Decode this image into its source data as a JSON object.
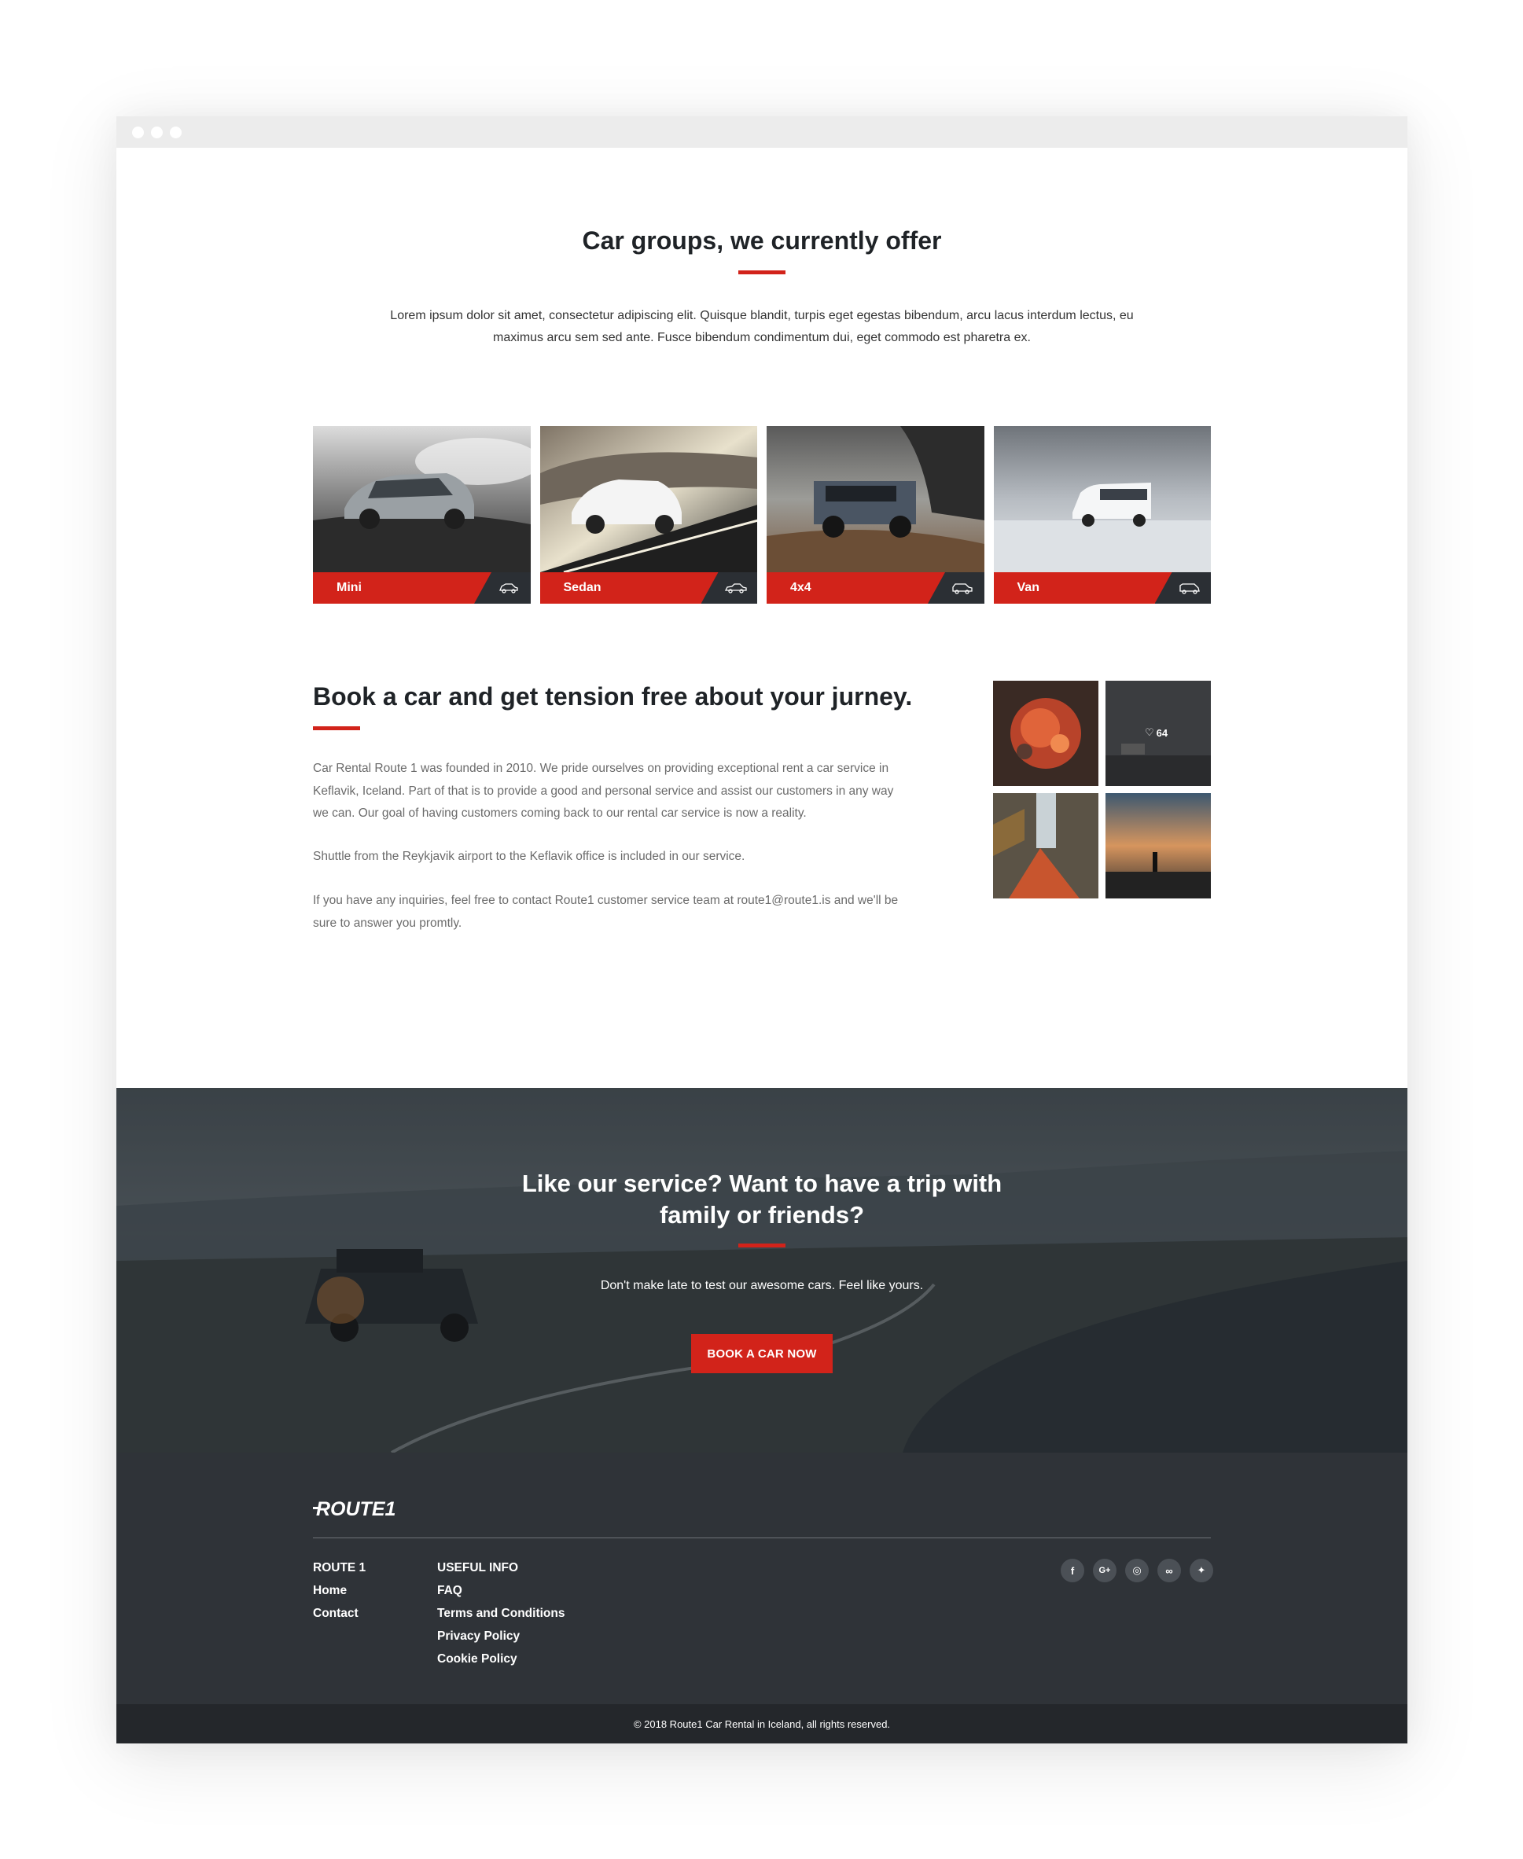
{
  "section_groups": {
    "title": "Car groups, we currently offer",
    "text": "Lorem ipsum dolor sit amet, consectetur adipiscing elit. Quisque blandit, turpis eget egestas bibendum, arcu lacus interdum lectus, eu maximus arcu sem sed ante. Fusce bibendum condimentum dui, eget commodo est pharetra ex.",
    "cards": [
      {
        "label": "Mini",
        "icon": "mini-car-icon"
      },
      {
        "label": "Sedan",
        "icon": "sedan-car-icon"
      },
      {
        "label": "4x4",
        "icon": "suv-car-icon"
      },
      {
        "label": "Van",
        "icon": "van-icon"
      }
    ]
  },
  "section_book": {
    "title": "Book a car and get tension free about your jurney.",
    "paragraphs": [
      "Car Rental Route 1 was founded in 2010. We pride ourselves on providing exceptional rent a car service in Keflavik, Iceland. Part of that is to provide a good and personal service and assist our customers in any way we can. Our goal of having customers coming back to our rental car service is now a reality.",
      "Shuttle from the Reykjavik airport to the Keflavik office is included in our service.",
      "If you have any inquiries, feel free to contact Route1 customer service team at route1@route1.is and we'll be sure to answer you promtly."
    ],
    "gallery_likes": "64"
  },
  "cta": {
    "title": "Like our service? Want to have a trip with family or friends?",
    "subtitle": "Don't make late to test our awesome cars. Feel like yours.",
    "button": "BOOK A CAR NOW"
  },
  "footer": {
    "logo": "ROUTE1",
    "col1": [
      "ROUTE 1",
      "Home",
      "Contact"
    ],
    "col2": [
      "USEFUL INFO",
      "FAQ",
      "Terms and Conditions",
      "Privacy Policy",
      "Cookie Policy"
    ],
    "social": [
      {
        "name": "facebook-icon",
        "glyph": "f"
      },
      {
        "name": "google-plus-icon",
        "glyph": "G+"
      },
      {
        "name": "instagram-icon",
        "glyph": "◎"
      },
      {
        "name": "tripadvisor-icon",
        "glyph": "∞"
      },
      {
        "name": "twitter-icon",
        "glyph": "✦"
      }
    ],
    "copyright": "© 2018 Route1 Car Rental in Iceland, all rights reserved."
  },
  "colors": {
    "accent": "#d2231a",
    "footer_bg": "#2f3338",
    "bottom_bar_bg": "#24272b"
  }
}
